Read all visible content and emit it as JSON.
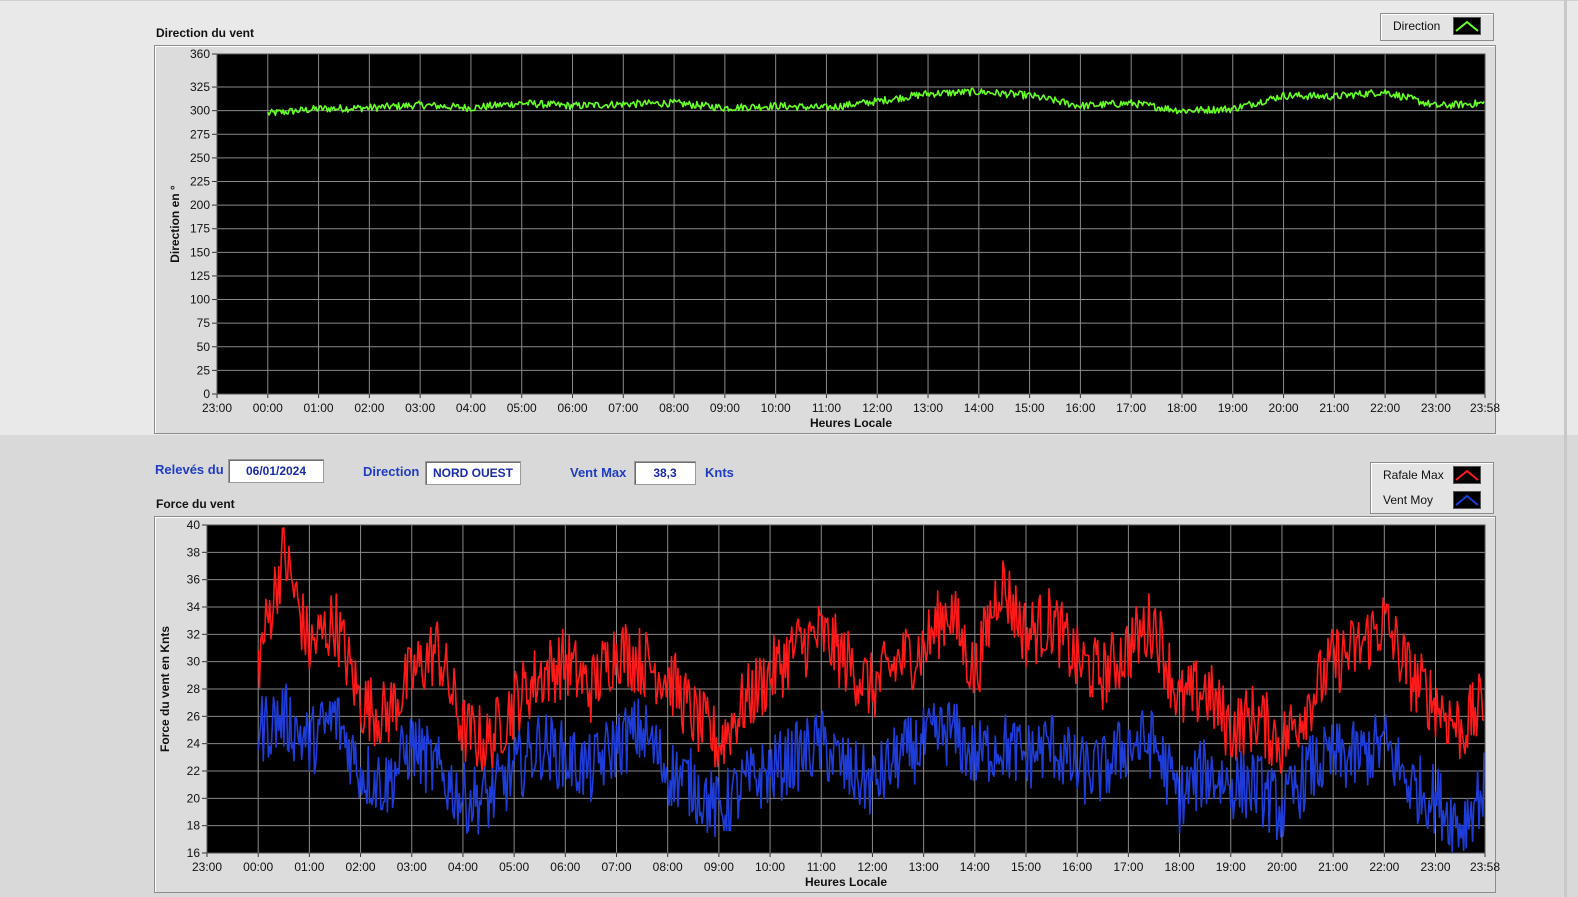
{
  "top": {
    "title": "Direction du vent",
    "legend": {
      "label": "Direction",
      "color": "#66ff22"
    }
  },
  "info": {
    "releves_label": "Relevés du",
    "date": "06/01/2024",
    "direction_label": "Direction",
    "direction_value": "NORD OUEST",
    "ventmax_label": "Vent Max",
    "ventmax_value": "38,3",
    "unit": "Knts"
  },
  "bottom": {
    "title": "Force du vent",
    "legend": [
      {
        "label": "Rafale Max",
        "color": "#ff1a1a"
      },
      {
        "label": "Vent Moy",
        "color": "#1e3cd8"
      }
    ]
  },
  "chart_data": [
    {
      "type": "line",
      "title": "Direction du vent",
      "xlabel": "Heures Locale",
      "ylabel": "Direction en °",
      "xtick_labels": [
        "23:00",
        "00:00",
        "01:00",
        "02:00",
        "03:00",
        "04:00",
        "05:00",
        "06:00",
        "07:00",
        "08:00",
        "09:00",
        "10:00",
        "11:00",
        "12:00",
        "13:00",
        "14:00",
        "15:00",
        "16:00",
        "17:00",
        "18:00",
        "19:00",
        "20:00",
        "21:00",
        "22:00",
        "23:00",
        "23:58"
      ],
      "xlim": [
        -60,
        1438
      ],
      "ylim": [
        0,
        360
      ],
      "ytick_labels": [
        "0",
        "25",
        "50",
        "75",
        "100",
        "125",
        "150",
        "175",
        "200",
        "225",
        "250",
        "275",
        "300",
        "325",
        "360"
      ],
      "grid": true,
      "legend_position": "top-right",
      "series": [
        {
          "name": "Direction",
          "color": "#66ff22",
          "x": [
            0,
            60,
            120,
            180,
            240,
            300,
            360,
            420,
            480,
            540,
            600,
            660,
            720,
            780,
            840,
            900,
            960,
            1020,
            1080,
            1140,
            1200,
            1260,
            1320,
            1380,
            1438
          ],
          "y": [
            297,
            302,
            303,
            306,
            303,
            308,
            305,
            307,
            308,
            303,
            305,
            303,
            310,
            318,
            320,
            316,
            305,
            308,
            300,
            302,
            316,
            315,
            320,
            305,
            308
          ]
        }
      ]
    },
    {
      "type": "line",
      "title": "Force du vent",
      "xlabel": "Heures Locale",
      "ylabel": "Force du vent en Knts",
      "xtick_labels": [
        "23:00",
        "00:00",
        "01:00",
        "02:00",
        "03:00",
        "04:00",
        "05:00",
        "06:00",
        "07:00",
        "08:00",
        "09:00",
        "10:00",
        "11:00",
        "12:00",
        "13:00",
        "14:00",
        "15:00",
        "16:00",
        "17:00",
        "18:00",
        "19:00",
        "20:00",
        "21:00",
        "22:00",
        "23:00",
        "23:58"
      ],
      "xlim": [
        -60,
        1438
      ],
      "ylim": [
        16,
        40
      ],
      "ytick_labels": [
        "16",
        "18",
        "20",
        "22",
        "24",
        "26",
        "28",
        "30",
        "32",
        "34",
        "36",
        "38",
        "40"
      ],
      "grid": true,
      "legend_position": "top-right",
      "series": [
        {
          "name": "Rafale Max",
          "color": "#ff1a1a",
          "x": [
            0,
            30,
            60,
            90,
            120,
            150,
            180,
            210,
            240,
            270,
            300,
            330,
            360,
            390,
            420,
            450,
            480,
            510,
            540,
            570,
            600,
            630,
            660,
            690,
            720,
            750,
            780,
            810,
            840,
            870,
            900,
            930,
            960,
            990,
            1020,
            1050,
            1080,
            1110,
            1140,
            1170,
            1200,
            1230,
            1260,
            1290,
            1320,
            1350,
            1380,
            1410,
            1438
          ],
          "y": [
            30,
            38,
            31,
            33,
            27,
            26,
            29,
            31,
            25,
            24,
            27,
            29,
            30,
            28,
            31,
            30,
            29,
            26,
            24,
            27,
            29,
            31,
            32,
            30,
            28,
            30,
            31,
            34,
            29,
            36,
            32,
            33,
            30,
            29,
            31,
            33,
            27,
            28,
            25,
            26,
            24,
            27,
            30,
            31,
            33,
            29,
            27,
            25,
            27
          ]
        },
        {
          "name": "Vent Moy",
          "color": "#1e3cd8",
          "x": [
            0,
            30,
            60,
            90,
            120,
            150,
            180,
            210,
            240,
            270,
            300,
            330,
            360,
            390,
            420,
            450,
            480,
            510,
            540,
            570,
            600,
            630,
            660,
            690,
            720,
            750,
            780,
            810,
            840,
            870,
            900,
            930,
            960,
            990,
            1020,
            1050,
            1080,
            1110,
            1140,
            1170,
            1200,
            1230,
            1260,
            1290,
            1320,
            1350,
            1380,
            1410,
            1438
          ],
          "y": [
            25,
            26,
            24,
            26,
            22,
            21,
            24,
            22,
            20,
            20,
            22,
            24,
            23,
            22,
            24,
            25,
            22,
            21,
            19,
            21,
            22,
            23,
            24,
            22,
            21,
            23,
            24,
            25,
            23,
            24,
            23,
            24,
            22,
            22,
            24,
            24,
            20,
            22,
            21,
            21,
            19,
            22,
            23,
            23,
            24,
            21,
            20,
            18,
            21
          ]
        }
      ]
    }
  ]
}
